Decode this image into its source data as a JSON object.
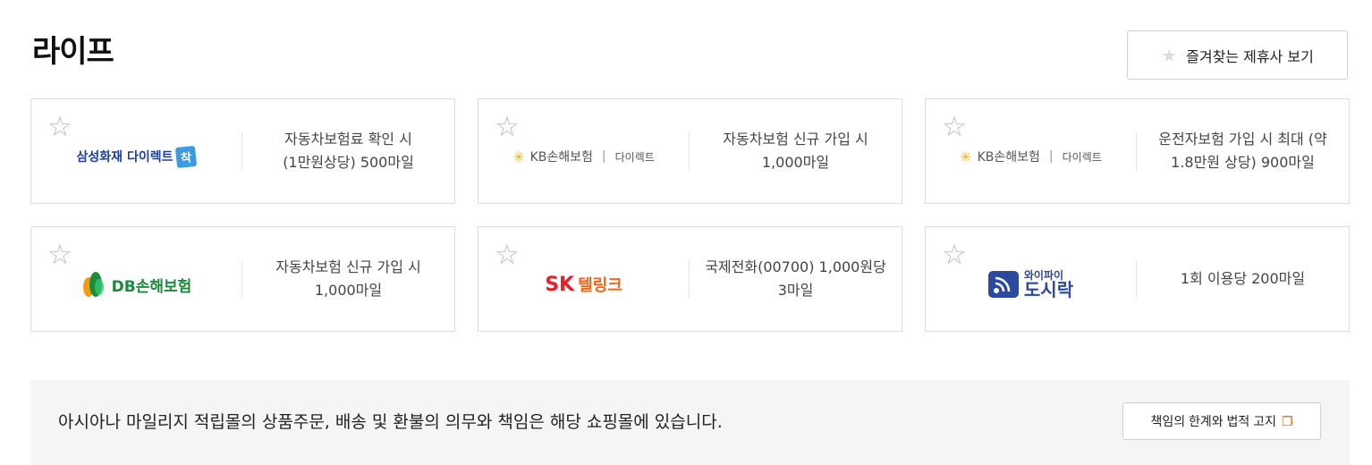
{
  "section": {
    "title": "라이프"
  },
  "favorites_button": {
    "label": "즐겨찾는 제휴사 보기",
    "icon": "star-icon"
  },
  "partners": [
    {
      "logo_text": "삼성화재 다이렉트",
      "logo_badge": "착",
      "benefit_line1": "자동차보험료 확인 시",
      "benefit_line2": "(1만원상당) 500마일"
    },
    {
      "logo_text": "KB손해보험",
      "logo_sub": "다이렉트",
      "benefit_line1": "자동차보험 신규 가입 시",
      "benefit_line2": "1,000마일"
    },
    {
      "logo_text": "KB손해보험",
      "logo_sub": "다이렉트",
      "benefit_line1": "운전자보험 가입 시 최대 (약",
      "benefit_line2": "1.8만원 상당) 900마일"
    },
    {
      "logo_text": "DB손해보험",
      "benefit_line1": "자동차보험 신규 가입 시",
      "benefit_line2": "1,000마일"
    },
    {
      "logo_text": "SK",
      "logo_sub": "텔링크",
      "benefit_line1": "국제전화(00700) 1,000원당",
      "benefit_line2": "3마일"
    },
    {
      "logo_text": "와이파이",
      "logo_sub": "도시락",
      "benefit_line1": "1회 이용당 200마일",
      "benefit_line2": ""
    }
  ],
  "notice": {
    "text": "아시아나 마일리지 적립몰의 상품주문, 배송 및 환불의 의무와 책임은 해당 쇼핑몰에 있습니다.",
    "legal_button_label": "책임의 한계와 법적 고지"
  },
  "colors": {
    "kb_yellow": "#f3b800",
    "db_green": "#1d8a3c",
    "sk_red": "#e8202a",
    "samsung_blue": "#1b3fa8",
    "wifi_blue": "#2b4a9e"
  }
}
